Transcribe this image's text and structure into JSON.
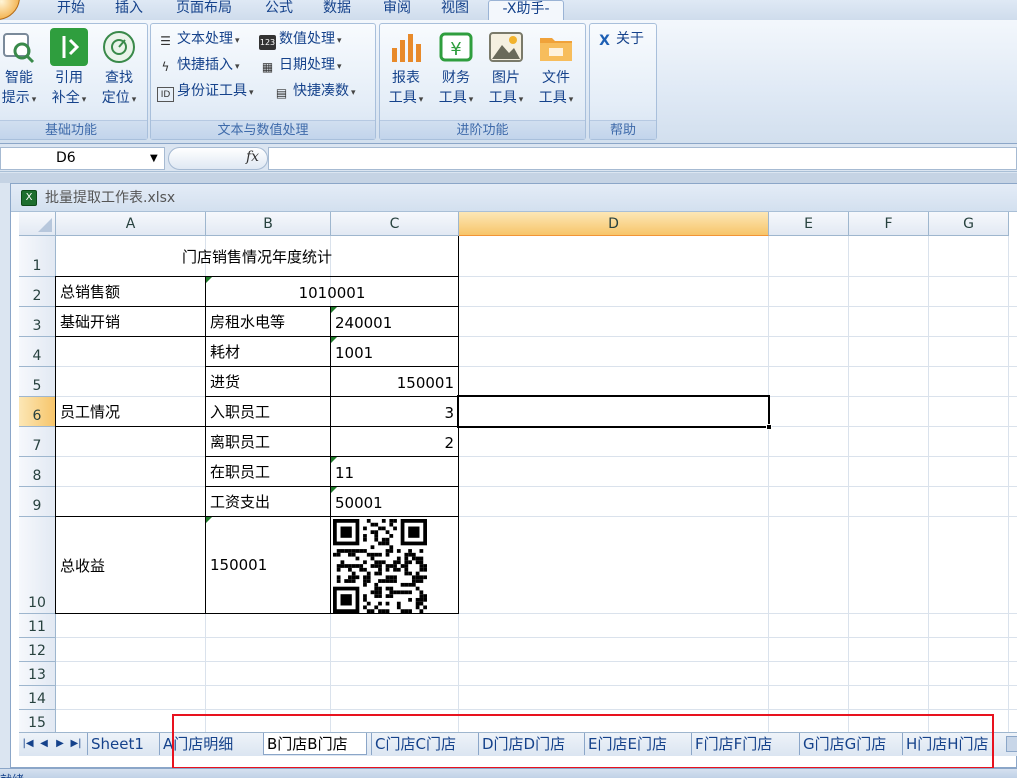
{
  "ribbon_tabs": [
    "开始",
    "插入",
    "页面布局",
    "公式",
    "数据",
    "审阅",
    "视图",
    "-X助手-"
  ],
  "active_ribbon_tab": "-X助手-",
  "ribbon": {
    "basic": {
      "label": "基础功能",
      "buttons": [
        {
          "line1": "智能",
          "line2": "提示",
          "icon": "search-icon"
        },
        {
          "line1": "引用",
          "line2": "补全",
          "icon": "reference-icon"
        },
        {
          "line1": "查找",
          "line2": "定位",
          "icon": "locate-icon"
        }
      ]
    },
    "text": {
      "label": "文本与数值处理",
      "items": [
        {
          "label": "文本处理",
          "icon": "text-lines-icon"
        },
        {
          "label": "数值处理",
          "icon": "number-icon"
        },
        {
          "label": "快捷插入",
          "icon": "lightning-icon"
        },
        {
          "label": "日期处理",
          "icon": "calendar-icon"
        },
        {
          "label": "身份证工具",
          "icon": "id-card-icon"
        },
        {
          "label": "快捷凑数",
          "icon": "calculator-icon"
        }
      ]
    },
    "advanced": {
      "label": "进阶功能",
      "buttons": [
        {
          "line1": "报表",
          "line2": "工具",
          "icon": "chart-icon"
        },
        {
          "line1": "财务",
          "line2": "工具",
          "icon": "finance-icon"
        },
        {
          "line1": "图片",
          "line2": "工具",
          "icon": "picture-icon"
        },
        {
          "line1": "文件",
          "line2": "工具",
          "icon": "folder-icon"
        }
      ]
    },
    "help": {
      "label": "帮助",
      "about": "关于"
    }
  },
  "formula_bar": {
    "name_box": "D6",
    "fx": "fx",
    "formula": ""
  },
  "workbook_title": "批量提取工作表.xlsx",
  "columns": [
    "A",
    "B",
    "C",
    "D",
    "E",
    "F",
    "G"
  ],
  "rows": [
    "1",
    "2",
    "3",
    "4",
    "5",
    "6",
    "7",
    "8",
    "9",
    "10",
    "11",
    "12",
    "13",
    "14",
    "15"
  ],
  "selected_cell": "D6",
  "cells": {
    "title": "门店销售情况年度统计",
    "a2": "总销售额",
    "b2": "1010001",
    "a3": "基础开销",
    "b3": "房租水电等",
    "c3": "240001",
    "b4": "耗材",
    "c4": "1001",
    "b5": "进货",
    "c5": "150001",
    "a6": "员工情况",
    "b6": "入职员工",
    "c6": "3",
    "b7": "离职员工",
    "c7": "2",
    "b8": "在职员工",
    "c8": "11",
    "b9": "工资支出",
    "c9": "50001",
    "a10": "总收益",
    "b10": "150001"
  },
  "sheet_tabs": [
    "Sheet1",
    "A门店明细",
    "B门店B门店",
    "C门店C门店",
    "D门店D门店",
    "E门店E门店",
    "F门店F门店",
    "G门店G门店",
    "H门店H门店"
  ],
  "active_sheet": "B门店B门店",
  "status": "就绪",
  "colors": {
    "highlight_box": "#e8121e",
    "selected_header": "#f7c56a",
    "ribbon_text": "#15428b"
  }
}
